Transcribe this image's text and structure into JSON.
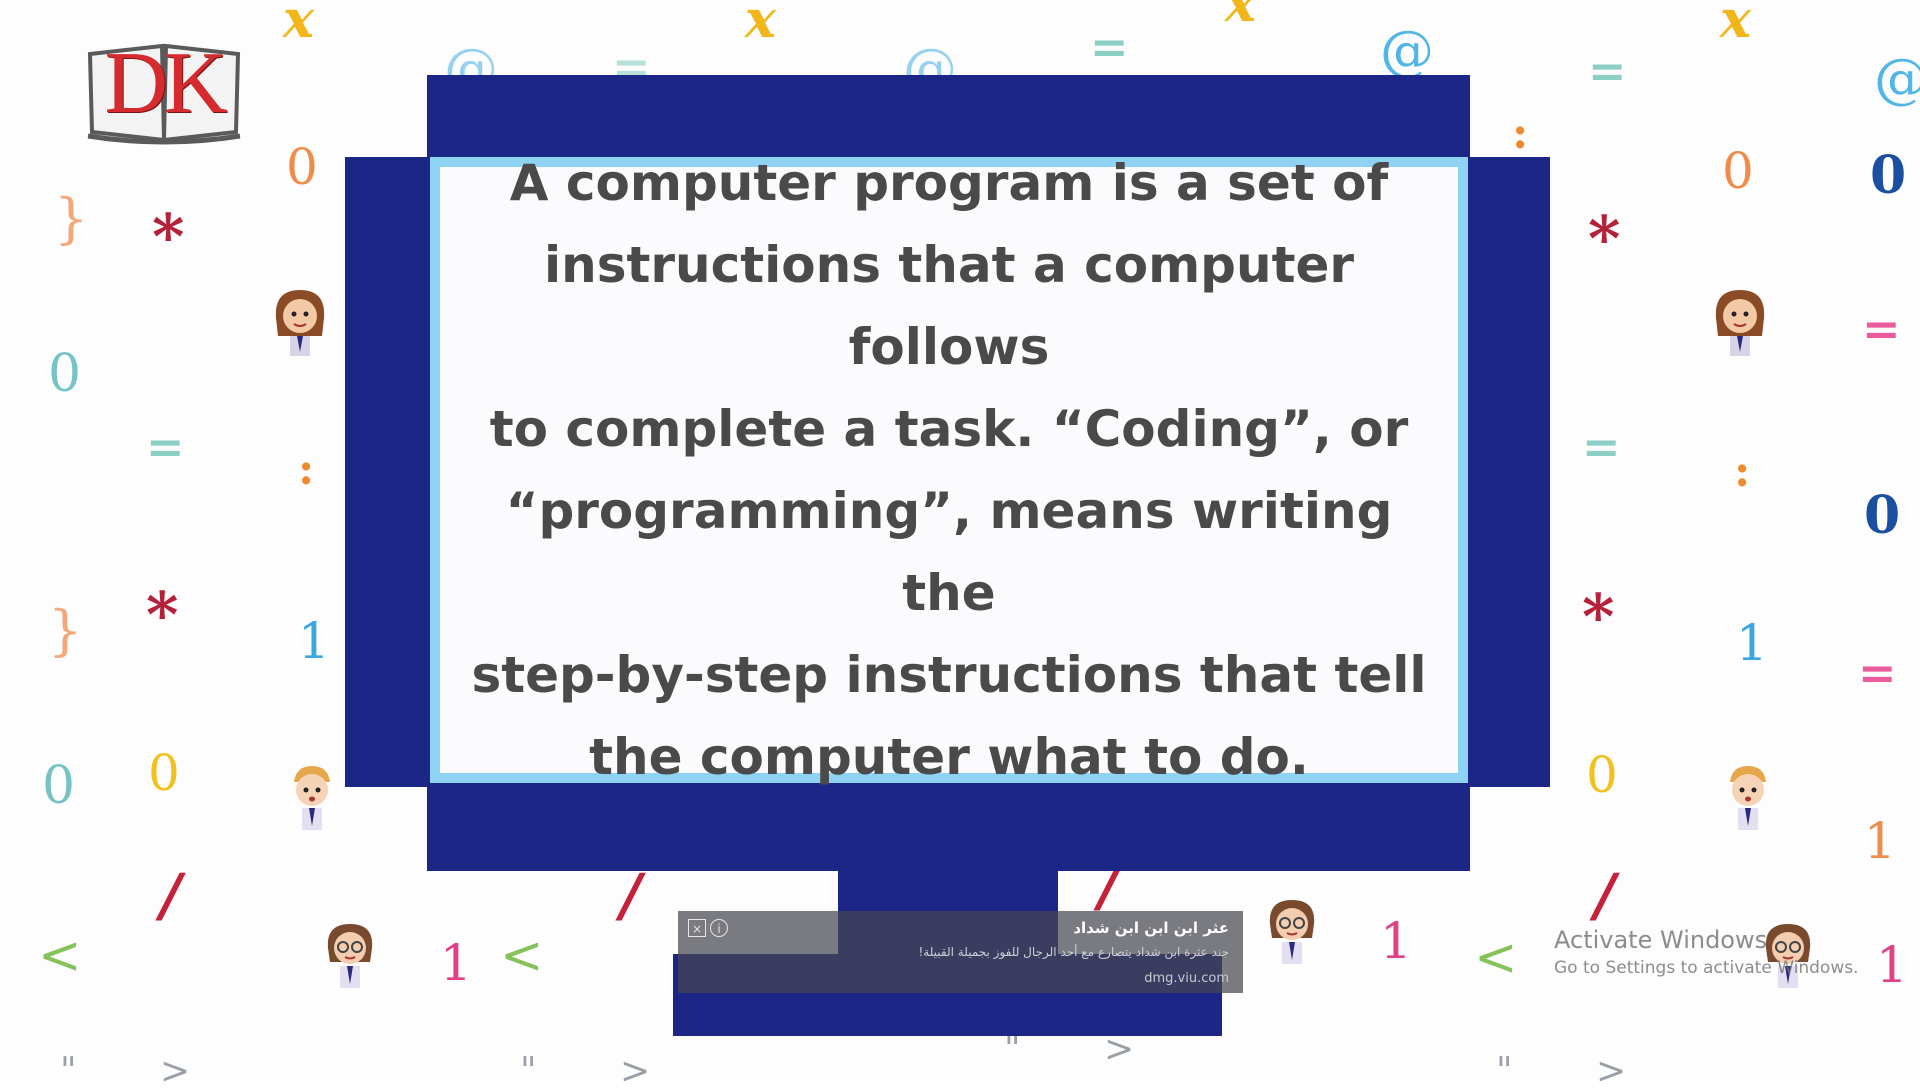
{
  "logo": {
    "text": "DK"
  },
  "screen": {
    "lines": [
      "A computer program is a set of",
      "instructions that a computer follows",
      "to complete a task. “Coding”, or",
      "“programming”, means writing the",
      "step-by-step instructions that tell",
      "the computer what to do."
    ]
  },
  "ad": {
    "title": "عثر ابن ابن ابن شداد",
    "description": "جند عثرة ابن شداد يتصارع مع أحد الرجال للفوز بجميلة القبيلة!",
    "url": "dmg.viu.com",
    "close_icon": "close-icon",
    "info_icon": "info-icon",
    "info_glyph": "i",
    "close_glyph": "×"
  },
  "watermark": {
    "title": "Activate Windows",
    "subtitle": "Go to Settings to activate Windows."
  },
  "glyphs": {
    "x": "x",
    "at": "@",
    "eq": "=",
    "zero": "0",
    "brace": "}",
    "star": "*",
    "colon": ":",
    "one": "1",
    "slash": "/",
    "lt": "<",
    "quote": "\"",
    "gt": ">"
  },
  "colors": {
    "monitor": "#1c2686",
    "screen_border": "#8fd3f4",
    "screen_text": "#4a4a4a",
    "logo_red": "#d52b2e"
  }
}
